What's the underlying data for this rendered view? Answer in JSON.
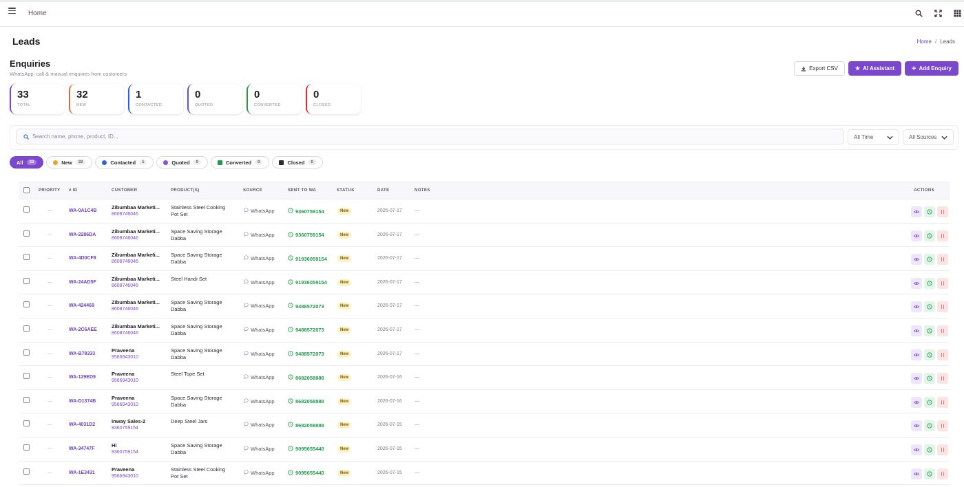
{
  "nav": {
    "home": "Home"
  },
  "page_header": "Leads",
  "breadcrumb": {
    "home": "Home",
    "current": "Leads"
  },
  "title": "Enquiries",
  "subtitle": "WhatsApp, call & manual enquiries from customers",
  "buttons": {
    "export": "Export CSV",
    "ai": "AI Assistant",
    "add": "Add Enquiry"
  },
  "stats": [
    {
      "num": "33",
      "label": "TOTAL",
      "color": "#7b47cc"
    },
    {
      "num": "32",
      "label": "NEW",
      "color": "#e8692c"
    },
    {
      "num": "1",
      "label": "CONTACTED",
      "color": "#2f63d6"
    },
    {
      "num": "0",
      "label": "QUOTED",
      "color": "#5b55d6"
    },
    {
      "num": "0",
      "label": "CONVERTED",
      "color": "#1f9d4a"
    },
    {
      "num": "0",
      "label": "CLOSED",
      "color": "#d62f3a"
    }
  ],
  "search": {
    "placeholder": "Search name, phone, product, ID..."
  },
  "filters": {
    "time": "All Time",
    "sources": "All Sources"
  },
  "chips": [
    {
      "label": "All",
      "count": "33"
    },
    {
      "label": "New",
      "count": "32",
      "color": "#e8a52c"
    },
    {
      "label": "Contacted",
      "count": "1",
      "color": "#2f63d6"
    },
    {
      "label": "Quoted",
      "count": "0",
      "color": "#8a4fd6"
    },
    {
      "label": "Converted",
      "count": "0",
      "color": "#1f9d4a"
    },
    {
      "label": "Closed",
      "count": "0",
      "color": "#2a2a33"
    }
  ],
  "table": {
    "headers": {
      "priority": "PRIORITY",
      "id": "# ID",
      "customer": "CUSTOMER",
      "products": "PRODUCT(S)",
      "source": "SOURCE",
      "sent": "SENT TO WA",
      "status": "STATUS",
      "date": "DATE",
      "notes": "NOTES",
      "actions": "ACTIONS"
    },
    "rows": [
      {
        "priority": "—",
        "id": "WA-0A1C4B",
        "name": "Zibumbaa Marketi...",
        "phone": "8608746046",
        "product": "Stainless Steel Cooking Pot Set",
        "source": "WhatsApp",
        "sent": "9360759154",
        "status": "New",
        "date": "2026-07-17",
        "notes": "—"
      },
      {
        "priority": "—",
        "id": "WA-2286DA",
        "name": "Zibumbaa Marketi...",
        "phone": "8608746046",
        "product": "Space Saving Storage Dabba",
        "source": "WhatsApp",
        "sent": "9360759154",
        "status": "New",
        "date": "2026-07-17",
        "notes": "—"
      },
      {
        "priority": "—",
        "id": "WA-4D0CF8",
        "name": "Zibumbaa Marketi...",
        "phone": "8608746046",
        "product": "Space Saving Storage Dabba",
        "source": "WhatsApp",
        "sent": "91936059154",
        "status": "New",
        "date": "2026-07-17",
        "notes": "—"
      },
      {
        "priority": "—",
        "id": "WA-24AD5F",
        "name": "Zibumbaa Marketi...",
        "phone": "8608746046",
        "product": "Steel Handi Set",
        "source": "WhatsApp",
        "sent": "91936059154",
        "status": "New",
        "date": "2026-07-17",
        "notes": "—"
      },
      {
        "priority": "—",
        "id": "WA-424469",
        "name": "Zibumbaa Marketi...",
        "phone": "8608746046",
        "product": "Space Saving Storage Dabba",
        "source": "WhatsApp",
        "sent": "9488572073",
        "status": "New",
        "date": "2026-07-17",
        "notes": "—"
      },
      {
        "priority": "—",
        "id": "WA-2C6AEE",
        "name": "Zibumbaa Marketi...",
        "phone": "8608746046",
        "product": "Space Saving Storage Dabba",
        "source": "WhatsApp",
        "sent": "9488572073",
        "status": "New",
        "date": "2026-07-17",
        "notes": "—"
      },
      {
        "priority": "—",
        "id": "WA-B78333",
        "name": "Praveena",
        "phone": "9566943010",
        "product": "Space Saving Storage Dabba",
        "source": "WhatsApp",
        "sent": "9488572073",
        "status": "New",
        "date": "2026-07-17",
        "notes": "—"
      },
      {
        "priority": "—",
        "id": "WA-129ED9",
        "name": "Praveena",
        "phone": "9566943010",
        "product": "Steel Tope Set",
        "source": "WhatsApp",
        "sent": "8682058888",
        "status": "New",
        "date": "2026-07-16",
        "notes": "—"
      },
      {
        "priority": "—",
        "id": "WA-D1374B",
        "name": "Praveena",
        "phone": "9566943010",
        "product": "Space Saving Storage Dabba",
        "source": "WhatsApp",
        "sent": "8682058888",
        "status": "New",
        "date": "2026-07-16",
        "notes": "—"
      },
      {
        "priority": "—",
        "id": "WA-4031D2",
        "name": "Inway Sales-2",
        "phone": "9360759154",
        "product": "Deep Steel Jars",
        "source": "WhatsApp",
        "sent": "8682058888",
        "status": "New",
        "date": "2026-07-15",
        "notes": "—"
      },
      {
        "priority": "—",
        "id": "WA-34747F",
        "name": "Hi",
        "phone": "9360759154",
        "product": "Space Saving Storage Dabba",
        "source": "WhatsApp",
        "sent": "9095655440",
        "status": "New",
        "date": "2026-07-15",
        "notes": "—"
      },
      {
        "priority": "—",
        "id": "WA-1E3431",
        "name": "Praveena",
        "phone": "9566943010",
        "product": "Stainless Steel Cooking Pot Set",
        "source": "WhatsApp",
        "sent": "9095655440",
        "status": "New",
        "date": "2026-07-15",
        "notes": "—"
      }
    ]
  }
}
